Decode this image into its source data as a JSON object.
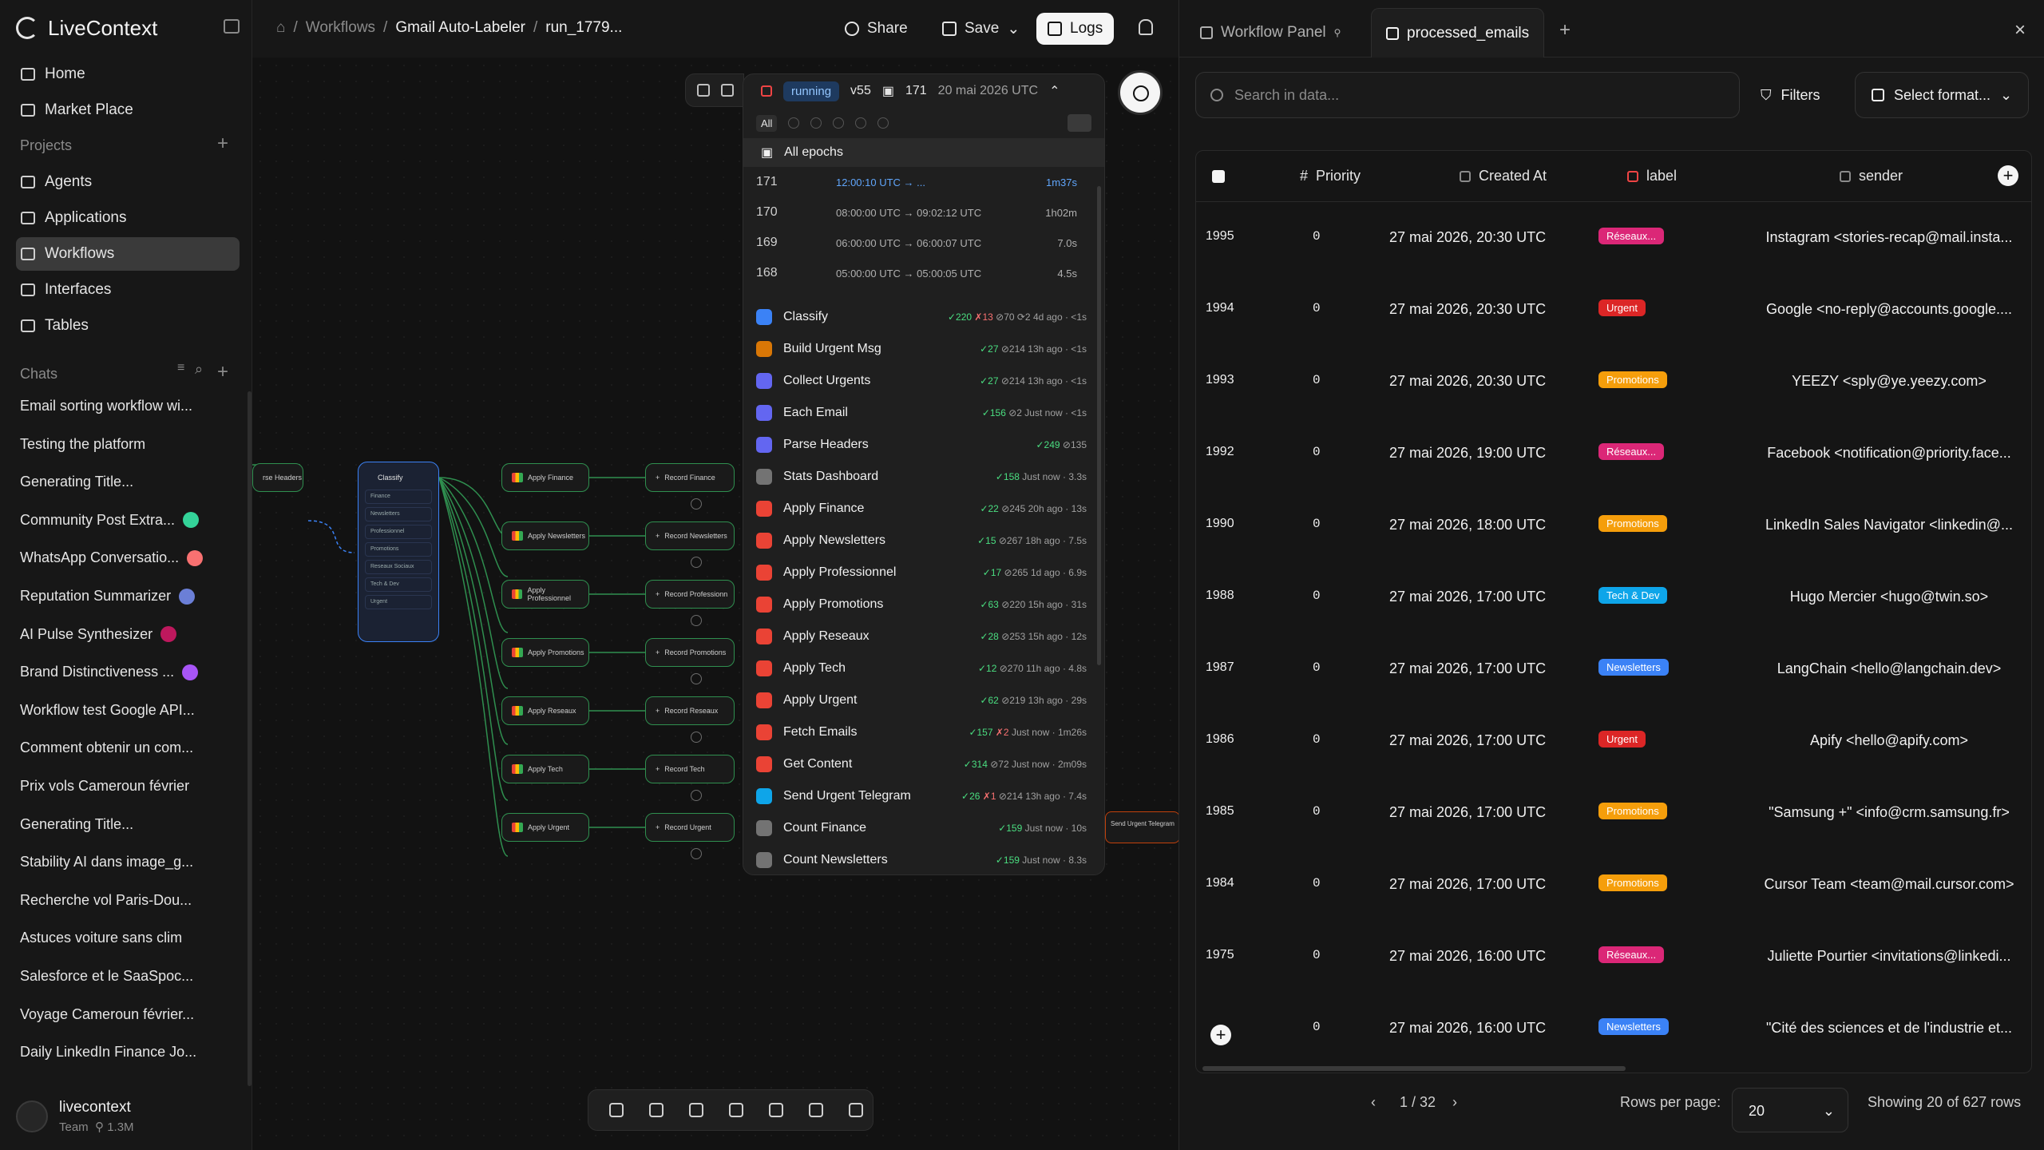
{
  "brand": {
    "name": "LiveContext"
  },
  "nav": [
    {
      "label": "Home"
    },
    {
      "label": "Market Place"
    }
  ],
  "projects": {
    "label": "Projects",
    "items": [
      {
        "label": "Agents"
      },
      {
        "label": "Applications"
      },
      {
        "label": "Workflows"
      },
      {
        "label": "Interfaces"
      },
      {
        "label": "Tables"
      }
    ]
  },
  "chats": {
    "label": "Chats",
    "items": [
      {
        "label": "Email sorting workflow wi...",
        "dot": ""
      },
      {
        "label": "Testing the platform",
        "dot": ""
      },
      {
        "label": "Generating Title...",
        "dot": ""
      },
      {
        "label": "Community Post Extra...",
        "dot": "#34d399"
      },
      {
        "label": "WhatsApp Conversatio...",
        "dot": "#f87171"
      },
      {
        "label": "Reputation Summarizer",
        "dot": "#6b7fd7"
      },
      {
        "label": "AI Pulse Synthesizer",
        "dot": "#be185d"
      },
      {
        "label": "Brand Distinctiveness ...",
        "dot": "#a855f7"
      },
      {
        "label": "Workflow test Google API...",
        "dot": ""
      },
      {
        "label": "Comment obtenir un com...",
        "dot": ""
      },
      {
        "label": "Prix vols Cameroun février",
        "dot": ""
      },
      {
        "label": "Generating Title...",
        "dot": ""
      },
      {
        "label": "Stability AI dans image_g...",
        "dot": ""
      },
      {
        "label": "Recherche vol Paris-Dou...",
        "dot": ""
      },
      {
        "label": "Astuces voiture sans clim",
        "dot": ""
      },
      {
        "label": "Salesforce et le SaaSpoc...",
        "dot": ""
      },
      {
        "label": "Voyage Cameroun février...",
        "dot": ""
      },
      {
        "label": "Daily LinkedIn Finance Jo...",
        "dot": ""
      }
    ]
  },
  "user": {
    "name": "livecontext",
    "team": "Team",
    "credits": "1.3M"
  },
  "breadcrumb": {
    "sep": "/",
    "workflows": "Workflows",
    "workflow": "Gmail Auto-Labeler",
    "run": "run_1779..."
  },
  "toolbar": {
    "share": "Share",
    "save": "Save",
    "logs": "Logs"
  },
  "run": {
    "status": "running",
    "version": "v55",
    "epoch": "171",
    "date": "20 mai 2026 UTC",
    "filter_all": "All",
    "all_epochs": "All epochs",
    "epochs": [
      {
        "num": "171",
        "range": "12:00:10 UTC → ...",
        "dur": "1m37s"
      },
      {
        "num": "170",
        "range": "08:00:00 UTC → 09:02:12 UTC",
        "dur": "1h02m"
      },
      {
        "num": "169",
        "range": "06:00:00 UTC → 06:00:07 UTC",
        "dur": "7.0s"
      },
      {
        "num": "168",
        "range": "05:00:00 UTC → 05:00:05 UTC",
        "dur": "4.5s"
      }
    ],
    "tasks": [
      {
        "name": "Classify",
        "ok": "✓220",
        "ko": "✗13",
        "rest": "⊘70 ⟳2 4d ago · <1s",
        "color": "#3b82f6"
      },
      {
        "name": "Build Urgent Msg",
        "ok": "✓27",
        "ko": "",
        "rest": "⊘214 13h ago · <1s",
        "color": "#d97706"
      },
      {
        "name": "Collect Urgents",
        "ok": "✓27",
        "ko": "",
        "rest": "⊘214 13h ago · <1s",
        "color": "#6366f1"
      },
      {
        "name": "Each Email",
        "ok": "✓156",
        "ko": "",
        "rest": "⊘2 Just now · <1s",
        "color": "#6366f1"
      },
      {
        "name": "Parse Headers",
        "ok": "✓249",
        "ko": "",
        "rest": "⊘135",
        "color": "#6366f1"
      },
      {
        "name": "Stats Dashboard",
        "ok": "✓158",
        "ko": "",
        "rest": "Just now · 3.3s",
        "color": "#737373"
      },
      {
        "name": "Apply Finance",
        "ok": "✓22",
        "ko": "",
        "rest": "⊘245 20h ago · 13s",
        "color": "#ea4335"
      },
      {
        "name": "Apply Newsletters",
        "ok": "✓15",
        "ko": "",
        "rest": "⊘267 18h ago · 7.5s",
        "color": "#ea4335"
      },
      {
        "name": "Apply Professionnel",
        "ok": "✓17",
        "ko": "",
        "rest": "⊘265 1d ago · 6.9s",
        "color": "#ea4335"
      },
      {
        "name": "Apply Promotions",
        "ok": "✓63",
        "ko": "",
        "rest": "⊘220 15h ago · 31s",
        "color": "#ea4335"
      },
      {
        "name": "Apply Reseaux",
        "ok": "✓28",
        "ko": "",
        "rest": "⊘253 15h ago · 12s",
        "color": "#ea4335"
      },
      {
        "name": "Apply Tech",
        "ok": "✓12",
        "ko": "",
        "rest": "⊘270 11h ago · 4.8s",
        "color": "#ea4335"
      },
      {
        "name": "Apply Urgent",
        "ok": "✓62",
        "ko": "",
        "rest": "⊘219 13h ago · 29s",
        "color": "#ea4335"
      },
      {
        "name": "Fetch Emails",
        "ok": "✓157",
        "ko": "✗2",
        "rest": "Just now · 1m26s",
        "color": "#ea4335"
      },
      {
        "name": "Get Content",
        "ok": "✓314",
        "ko": "",
        "rest": "⊘72 Just now · 2m09s",
        "color": "#ea4335"
      },
      {
        "name": "Send Urgent Telegram",
        "ok": "✓26",
        "ko": "✗1",
        "rest": "⊘214 13h ago · 7.4s",
        "color": "#0ea5e9"
      },
      {
        "name": "Count Finance",
        "ok": "✓159",
        "ko": "",
        "rest": "Just now · 10s",
        "color": "#737373"
      },
      {
        "name": "Count Newsletters",
        "ok": "✓159",
        "ko": "",
        "rest": "Just now · 8.3s",
        "color": "#737373"
      }
    ]
  },
  "canvas": {
    "classify": "Classify",
    "classify_rows": [
      "Finance",
      "Newsletters",
      "Professionnel",
      "Promotions",
      "Reseaux Sociaux",
      "Tech & Dev",
      "Urgent"
    ],
    "parse": "rse Headers",
    "apply": [
      "Apply Finance",
      "Apply Newsletters",
      "Apply Professionnel",
      "Apply Promotions",
      "Apply Reseaux",
      "Apply Tech",
      "Apply Urgent"
    ],
    "record": [
      "Record Finance",
      "Record Newsletters",
      "Record Professionn",
      "Record Promotions",
      "Record Reseaux",
      "Record Tech",
      "Record Urgent"
    ],
    "telegram": "Send Urgent Telegram"
  },
  "panel": {
    "tabs": [
      {
        "label": "Workflow Panel"
      },
      {
        "label": "processed_emails"
      }
    ],
    "search_placeholder": "Search in data...",
    "filters": "Filters",
    "format": "Select format...",
    "columns": {
      "priority": "Priority",
      "created": "Created At",
      "label": "label",
      "sender": "sender"
    },
    "rows": [
      {
        "id": "1995",
        "pr": "0",
        "dt": "27 mai 2026, 20:30 UTC",
        "label": "Réseaux...",
        "lc": "#db2777",
        "sender": "Instagram <stories-recap@mail.insta..."
      },
      {
        "id": "1994",
        "pr": "0",
        "dt": "27 mai 2026, 20:30 UTC",
        "label": "Urgent",
        "lc": "#dc2626",
        "sender": "Google <no-reply@accounts.google...."
      },
      {
        "id": "1993",
        "pr": "0",
        "dt": "27 mai 2026, 20:30 UTC",
        "label": "Promotions",
        "lc": "#f59e0b",
        "sender": "YEEZY <sply@ye.yeezy.com>"
      },
      {
        "id": "1992",
        "pr": "0",
        "dt": "27 mai 2026, 19:00 UTC",
        "label": "Réseaux...",
        "lc": "#db2777",
        "sender": "Facebook <notification@priority.face..."
      },
      {
        "id": "1990",
        "pr": "0",
        "dt": "27 mai 2026, 18:00 UTC",
        "label": "Promotions",
        "lc": "#f59e0b",
        "sender": "LinkedIn Sales Navigator <linkedin@..."
      },
      {
        "id": "1988",
        "pr": "0",
        "dt": "27 mai 2026, 17:00 UTC",
        "label": "Tech & Dev",
        "lc": "#0ea5e9",
        "sender": "Hugo Mercier <hugo@twin.so>"
      },
      {
        "id": "1987",
        "pr": "0",
        "dt": "27 mai 2026, 17:00 UTC",
        "label": "Newsletters",
        "lc": "#3b82f6",
        "sender": "LangChain <hello@langchain.dev>"
      },
      {
        "id": "1986",
        "pr": "0",
        "dt": "27 mai 2026, 17:00 UTC",
        "label": "Urgent",
        "lc": "#dc2626",
        "sender": "Apify <hello@apify.com>"
      },
      {
        "id": "1985",
        "pr": "0",
        "dt": "27 mai 2026, 17:00 UTC",
        "label": "Promotions",
        "lc": "#f59e0b",
        "sender": "\"Samsung +\" <info@crm.samsung.fr>"
      },
      {
        "id": "1984",
        "pr": "0",
        "dt": "27 mai 2026, 17:00 UTC",
        "label": "Promotions",
        "lc": "#f59e0b",
        "sender": "Cursor Team <team@mail.cursor.com>"
      },
      {
        "id": "1975",
        "pr": "0",
        "dt": "27 mai 2026, 16:00 UTC",
        "label": "Réseaux...",
        "lc": "#db2777",
        "sender": "Juliette Pourtier <invitations@linkedi..."
      },
      {
        "id": "",
        "pr": "0",
        "dt": "27 mai 2026, 16:00 UTC",
        "label": "Newsletters",
        "lc": "#3b82f6",
        "sender": "\"Cité des sciences et de l'industrie et..."
      }
    ],
    "page": "1 / 32",
    "rows_per_page_label": "Rows per page:",
    "rows_per_page": "20",
    "showing": "Showing 20 of 627 rows"
  }
}
